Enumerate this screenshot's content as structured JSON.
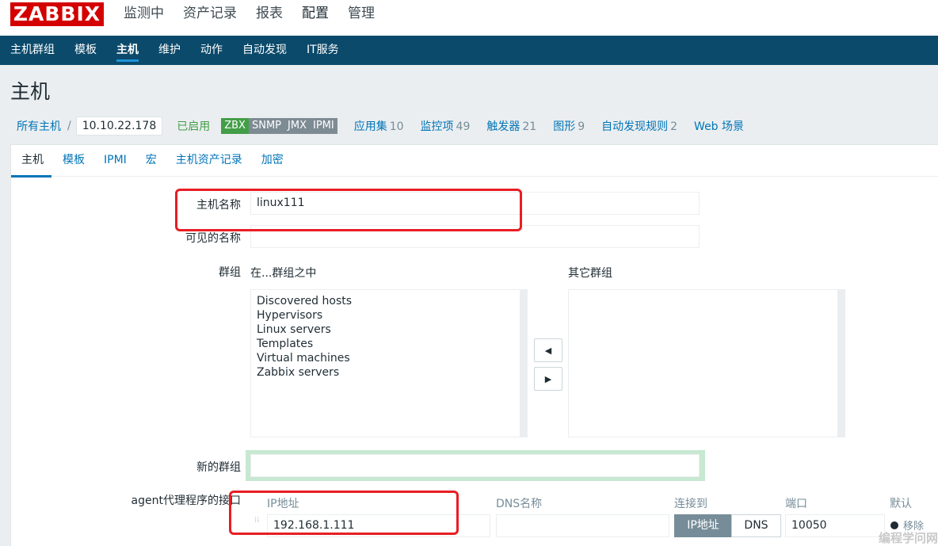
{
  "logo": "ZABBIX",
  "main_menu": [
    {
      "label": "监测中",
      "active": false
    },
    {
      "label": "资产记录",
      "active": false
    },
    {
      "label": "报表",
      "active": false
    },
    {
      "label": "配置",
      "active": true
    },
    {
      "label": "管理",
      "active": false
    }
  ],
  "sub_menu": [
    {
      "label": "主机群组",
      "active": false
    },
    {
      "label": "模板",
      "active": false
    },
    {
      "label": "主机",
      "active": true
    },
    {
      "label": "维护",
      "active": false
    },
    {
      "label": "动作",
      "active": false
    },
    {
      "label": "自动发现",
      "active": false
    },
    {
      "label": "IT服务",
      "active": false
    }
  ],
  "page_title": "主机",
  "breadcrumb": {
    "all_hosts": "所有主机",
    "separator": "/",
    "current_host": "10.10.22.178",
    "status": "已启用",
    "availability": {
      "zbx": "ZBX",
      "snmp": "SNMP",
      "jmx": "JMX",
      "ipmi": "IPMI"
    },
    "nav": [
      {
        "label": "应用集",
        "count": "10"
      },
      {
        "label": "监控项",
        "count": "49"
      },
      {
        "label": "触发器",
        "count": "21"
      },
      {
        "label": "图形",
        "count": "9"
      },
      {
        "label": "自动发现规则",
        "count": "2"
      },
      {
        "label": "Web 场景",
        "count": ""
      }
    ]
  },
  "tabs": [
    "主机",
    "模板",
    "IPMI",
    "宏",
    "主机资产记录",
    "加密"
  ],
  "form": {
    "host_name_label": "主机名称",
    "host_name_value": "linux111",
    "visible_name_label": "可见的名称",
    "visible_name_value": "",
    "groups_label": "群组",
    "in_groups_label": "在...群组之中",
    "other_groups_label": "其它群组",
    "in_groups": [
      "Discovered hosts",
      "Hypervisors",
      "Linux servers",
      "Templates",
      "Virtual machines",
      "Zabbix servers"
    ],
    "other_groups": [],
    "new_group_label": "新的群组",
    "new_group_value": "",
    "agent_iface_label": "agent代理程序的接口",
    "iface_headers": {
      "ip": "IP地址",
      "dns": "DNS名称",
      "connect": "连接到",
      "port": "端口",
      "default": "默认"
    },
    "iface_ip": "192.168.1.111",
    "iface_dns": "",
    "connect_ip": "IP地址",
    "connect_dns": "DNS",
    "iface_port": "10050",
    "remove_label": "移除"
  },
  "watermark": "编程学问网",
  "colors": {
    "brand_red": "#d40000",
    "nav_blue": "#0b4a6b",
    "link": "#0275b8",
    "enabled_green": "#429e47",
    "highlight_red": "#e81e24"
  }
}
